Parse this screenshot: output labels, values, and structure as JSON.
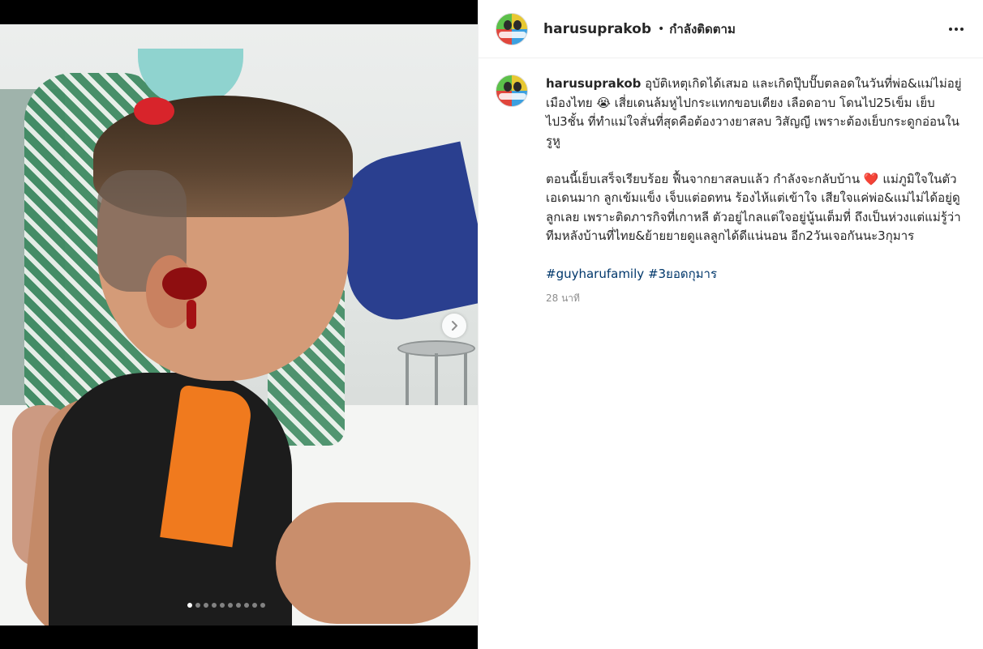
{
  "post": {
    "username": "harusuprakob",
    "follow_status": "กำลังติดตาม",
    "separator": "•",
    "more_icon": "more-horizontal-icon"
  },
  "media": {
    "carousel_count": 10,
    "active_index": 0
  },
  "caption": {
    "username": "harusuprakob",
    "line1": "อุบัติเหตุเกิดได้เสมอ และเกิดปุ๊บปั๊บตลอดในวันที่พ่อ&แม่ไม่อยู่เมืองไทย 😭 เสี่ยเดนล้มหูไปกระแทกขอบเตียง เลือดอาบ โดนไป25เข็ม เย็บไป3ชั้น ที่ทำแม่ใจสั่นที่สุดคือต้องวางยาสลบ วิสัญญี เพราะต้องเย็บกระดูกอ่อนในรูหู",
    "paragraph2": "ตอนนี้เย็บเสร็จเรียบร้อย ฟื้นจากยาสลบแล้ว กำลังจะกลับบ้าน ❤️ แม่ภูมิใจในตัวเอเดนมาก ลูกเข้มแข็ง เจ็บแต่อดทน ร้องไห้แต่เข้าใจ เสียใจแค่พ่อ&แม่ไม่ได้อยู่ดูลูกเลย เพราะติดภารกิจที่เกาหลี ตัวอยู่ไกลแต่ใจอยู่นู้นเต็มที่ ถึงเป็นห่วงแต่แม่รู้ว่าทีมหลังบ้านที่ไทย&ย้ายยายดูแลลูกได้ดีแน่นอน อีก2วันเจอกันนะ3กุมาร",
    "hashtag1": "#guyharufamily",
    "hashtag2": "#3ยอดกุมาร",
    "timestamp": "28 นาที"
  }
}
